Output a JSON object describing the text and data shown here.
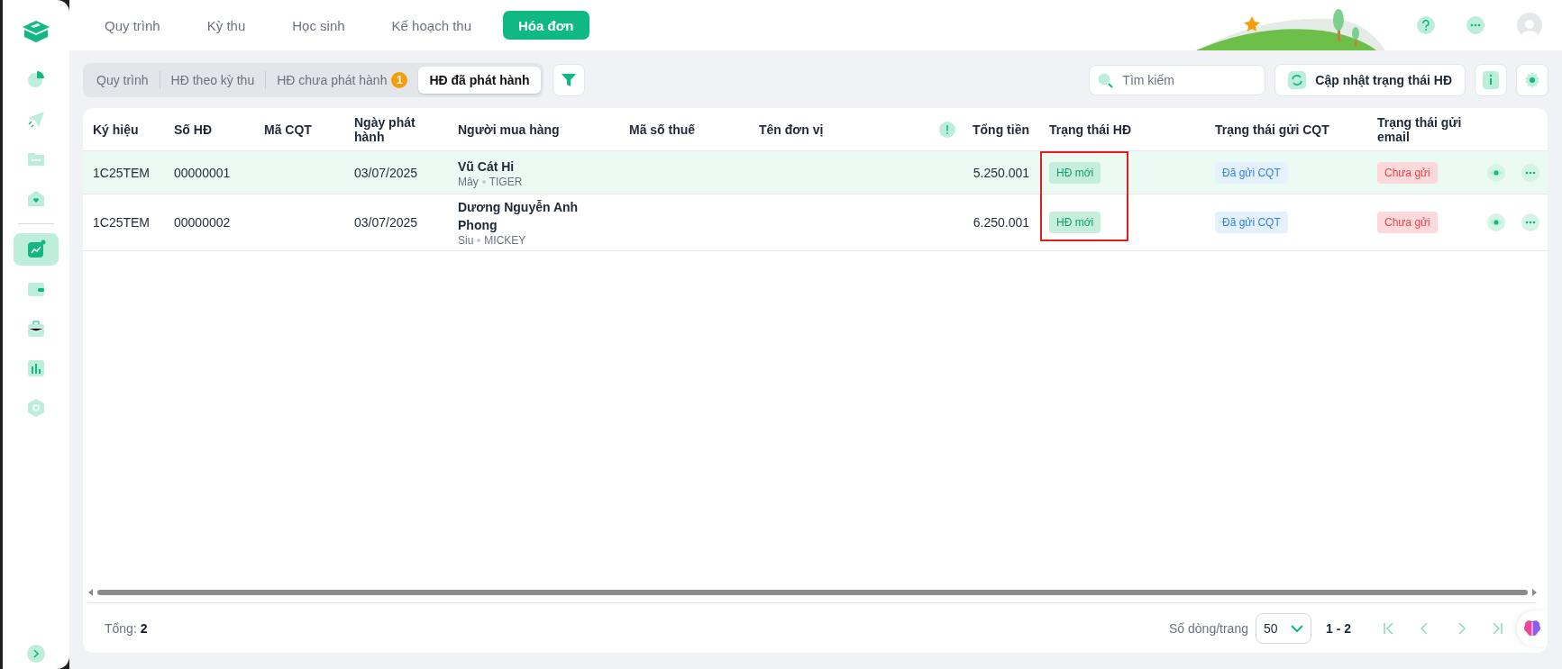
{
  "sidebar": {
    "items": [
      {
        "kind": "pie",
        "selected": false
      },
      {
        "kind": "send",
        "selected": false
      },
      {
        "kind": "folder",
        "selected": false
      },
      {
        "kind": "home",
        "selected": false
      },
      {
        "kind": "trend",
        "selected": true
      },
      {
        "kind": "wallet",
        "selected": false
      },
      {
        "kind": "briefcase",
        "selected": false
      },
      {
        "kind": "bars",
        "selected": false
      },
      {
        "kind": "hexagon",
        "selected": false
      }
    ]
  },
  "top_nav": {
    "tabs": [
      {
        "label": "Quy trình",
        "selected": false
      },
      {
        "label": "Kỳ thu",
        "selected": false
      },
      {
        "label": "Học sinh",
        "selected": false
      },
      {
        "label": "Kế hoạch thu",
        "selected": false
      },
      {
        "label": "Hóa đơn",
        "selected": true
      }
    ]
  },
  "sub_tabs": [
    {
      "label": "Quy trình",
      "selected": false
    },
    {
      "label": "HĐ theo kỳ thu",
      "selected": false
    },
    {
      "label": "HĐ chưa phát hành",
      "selected": false,
      "badge": "1"
    },
    {
      "label": "HĐ đã phát hành",
      "selected": true
    }
  ],
  "search": {
    "placeholder": "Tìm kiếm"
  },
  "update_button": "Cập nhật trạng thái HĐ",
  "table": {
    "status_highlighted": true,
    "columns": [
      "Ký hiệu",
      "Số HĐ",
      "Mã CQT",
      "Ngày phát hành",
      "Người mua hàng",
      "Mã số thuế",
      "Tên đơn vị",
      "Tổng tiền",
      "Trạng thái HĐ",
      "Trạng thái gửi CQT",
      "Trạng thái gửi email"
    ],
    "rows": [
      {
        "selected": true,
        "symbol": "1C25TEM",
        "number": "00000001",
        "date": "03/07/2025",
        "buyer": "Vũ Cát Hi",
        "class": "Mây",
        "nickname": "TIGER",
        "total": "5.250.001",
        "status": {
          "label": "HĐ mới",
          "kind": "new"
        },
        "cqt_status": {
          "label": "Đã gửi CQT",
          "kind": "sent"
        },
        "email_status": {
          "label": "Chưa gửi",
          "kind": "unsent"
        }
      },
      {
        "selected": false,
        "symbol": "1C25TEM",
        "number": "00000002",
        "date": "03/07/2025",
        "buyer": "Dương Nguyễn Anh Phong",
        "class": "Siu",
        "nickname": "MICKEY",
        "total": "6.250.001",
        "status": {
          "label": "HĐ mới",
          "kind": "new"
        },
        "cqt_status": {
          "label": "Đã gửi CQT",
          "kind": "sent"
        },
        "email_status": {
          "label": "Chưa gửi",
          "kind": "unsent"
        }
      }
    ]
  },
  "footer": {
    "total_label": "Tổng:",
    "total": "2",
    "page_size_label": "Số dòng/trang",
    "page_size": "50",
    "range": "1 - 2"
  }
}
